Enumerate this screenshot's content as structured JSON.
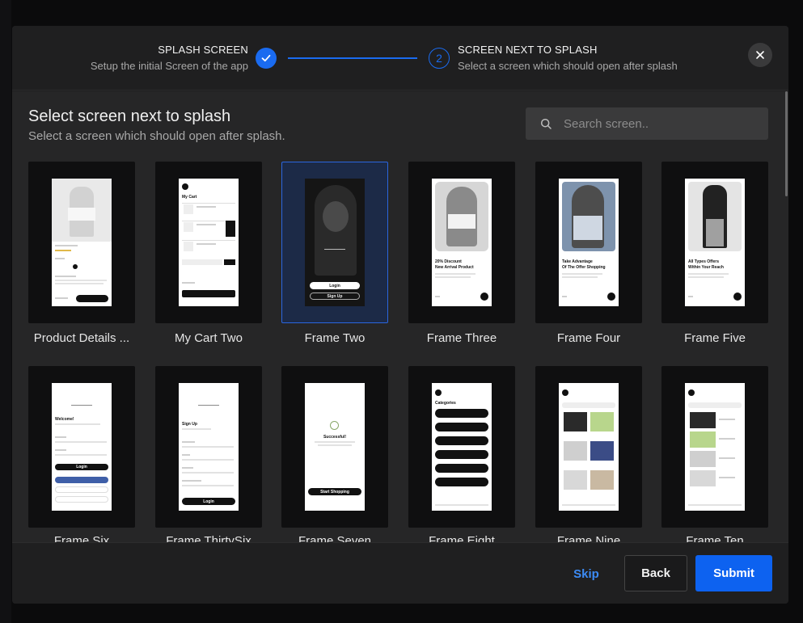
{
  "stepper": {
    "step1": {
      "title": "SPLASH SCREEN",
      "subtitle": "Setup the initial Screen of the app"
    },
    "step2": {
      "number": "2",
      "title": "SCREEN NEXT TO SPLASH",
      "subtitle": "Select a screen which should open after splash"
    }
  },
  "main": {
    "title": "Select screen next to splash",
    "subtitle": "Select a screen which should open after splash.",
    "search_placeholder": "Search screen.."
  },
  "screens": [
    {
      "label": "Product Details ..."
    },
    {
      "label": "My Cart Two"
    },
    {
      "label": "Frame Two",
      "selected": true
    },
    {
      "label": "Frame Three"
    },
    {
      "label": "Frame Four"
    },
    {
      "label": "Frame Five"
    },
    {
      "label": "Frame Six"
    },
    {
      "label": "Frame ThirtySix"
    },
    {
      "label": "Frame Seven"
    },
    {
      "label": "Frame Eight"
    },
    {
      "label": "Frame Nine"
    },
    {
      "label": "Frame Ten"
    }
  ],
  "preview_text": {
    "frame_three": [
      "20% Discount",
      "New Arrival Product"
    ],
    "frame_four": [
      "Take Advantage",
      "Of The Offer Shopping"
    ],
    "frame_five": [
      "All Types Offers",
      "Within Your Reach"
    ],
    "frame_seven": "Successful!",
    "frame_six": "Welcome!",
    "frame_thirtysix": "Sign Up",
    "my_cart": "My Cart",
    "frame_eight": "Categories",
    "login": "Login",
    "sign_up": "Sign Up",
    "start_shopping": "Start Shopping"
  },
  "footer": {
    "skip": "Skip",
    "back": "Back",
    "submit": "Submit"
  },
  "colors": {
    "accent": "#0d62f0",
    "selected_bg": "#1c2a47"
  }
}
